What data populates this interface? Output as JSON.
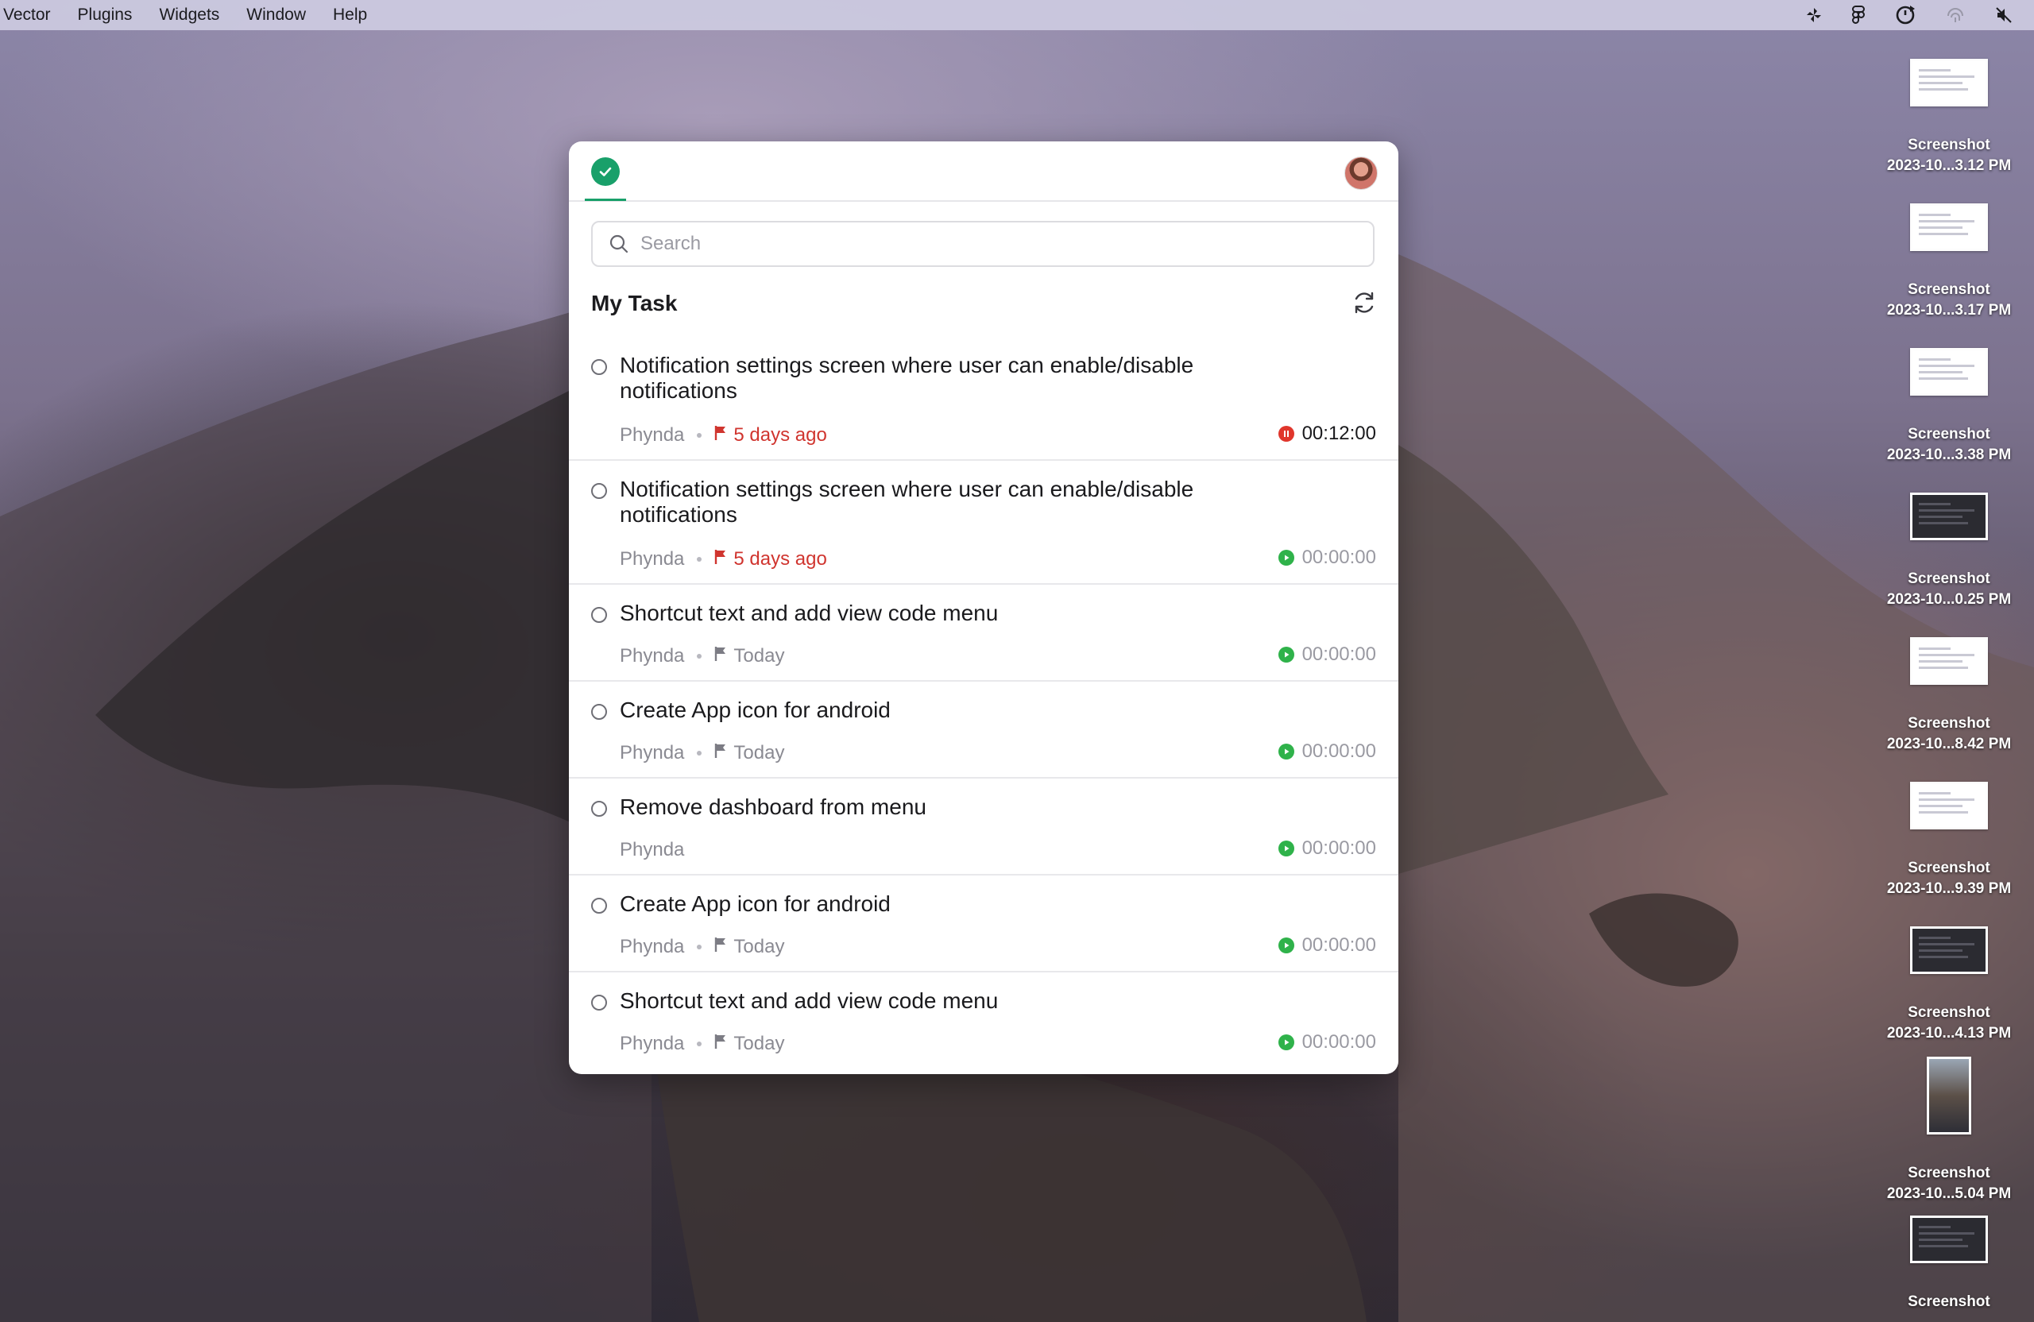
{
  "menubar": {
    "items": [
      "Vector",
      "Plugins",
      "Widgets",
      "Window",
      "Help"
    ],
    "status_icons": [
      "pinwheel-icon",
      "figma-icon",
      "sync-icon",
      "fingerprint-icon",
      "mute-icon"
    ]
  },
  "desktop": {
    "icons": [
      {
        "name": "Screenshot",
        "date": "2023-10...3.12 PM",
        "thumb": "light"
      },
      {
        "name": "Screenshot",
        "date": "2023-10...3.17 PM",
        "thumb": "light"
      },
      {
        "name": "Screenshot",
        "date": "2023-10...3.38 PM",
        "thumb": "light"
      },
      {
        "name": "Screenshot",
        "date": "2023-10...0.25 PM",
        "thumb": "dark"
      },
      {
        "name": "Screenshot",
        "date": "2023-10...8.42 PM",
        "thumb": "light"
      },
      {
        "name": "Screenshot",
        "date": "2023-10...9.39 PM",
        "thumb": "light"
      },
      {
        "name": "Screenshot",
        "date": "2023-10...4.13 PM",
        "thumb": "dark"
      },
      {
        "name": "Screenshot",
        "date": "2023-10...5.04 PM",
        "thumb": "photo"
      },
      {
        "name": "Screenshot",
        "date": "",
        "thumb": "dark"
      }
    ]
  },
  "app": {
    "brand_color": "#19a06a",
    "search": {
      "placeholder": "Search",
      "value": ""
    },
    "section_title": "My Task",
    "tasks": [
      {
        "title": "Notification settings screen where user can enable/disable notifications",
        "assignee": "Phynda",
        "due": "5 days ago",
        "overdue": true,
        "timer": "00:12:00",
        "running": true
      },
      {
        "title": "Notification settings screen where user can enable/disable notifications",
        "assignee": "Phynda",
        "due": "5 days ago",
        "overdue": true,
        "timer": "00:00:00",
        "running": false
      },
      {
        "title": "Shortcut text and add view code menu",
        "assignee": "Phynda",
        "due": "Today",
        "overdue": false,
        "timer": "00:00:00",
        "running": false
      },
      {
        "title": "Create App icon for android",
        "assignee": "Phynda",
        "due": "Today",
        "overdue": false,
        "timer": "00:00:00",
        "running": false
      },
      {
        "title": "Remove dashboard from menu",
        "assignee": "Phynda",
        "due": "",
        "overdue": false,
        "timer": "00:00:00",
        "running": false
      },
      {
        "title": "Create App icon for android",
        "assignee": "Phynda",
        "due": "Today",
        "overdue": false,
        "timer": "00:00:00",
        "running": false
      },
      {
        "title": "Shortcut text and add view code menu",
        "assignee": "Phynda",
        "due": "Today",
        "overdue": false,
        "timer": "00:00:00",
        "running": false
      }
    ]
  }
}
